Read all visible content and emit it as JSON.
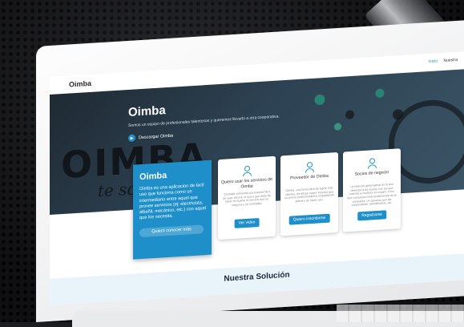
{
  "nav": {
    "logo": "Oimba",
    "links": [
      "Inicio",
      "Nuestra"
    ]
  },
  "hero": {
    "title": "Oimba",
    "subtitle": "Somos un equipo de profesionales talentosos y queremos llevarlo a otra cooperativa.",
    "button_label": "Descargar Oimba",
    "bg_word": "OIMBA",
    "bg_script": "te soluciona"
  },
  "intro_card": {
    "title": "Oimba",
    "text": "Oimba es una aplicacion de facil uso que funciona como un intermediario entre aquel que provee servicios (ej: electricista, albañil, mecánico, etc.) con aquel que los necesita.",
    "button_label": "Quiero conocer más"
  },
  "cards": [
    {
      "title": "Quiero usar los servicios de Oimba",
      "text": "Contratá, presenta una manera fácil de usar. Ahorrá, lo único que debe de hacer es buscar el servicio que su negocio y ¡lo contratás!",
      "button_label": "Ver video"
    },
    {
      "title": "Proveedor de Oimba",
      "text": "Oimba, una forma fácil de lograr mas clientes, de eficaz mayor impulso que un previo profesionalismo respaldando adentro de hacer uso.",
      "button_label": "Quiero inscribirme"
    },
    {
      "title": "Socios de negocio",
      "text": "La relación ganar-ganar es lo que describe a los socios con los que nuestra a conducir en equipo. A los que componen esta fundamental de la compañía. Un apuesto que las cooperativas, atendiéndolo, etc.",
      "button_label": "Registrarse"
    }
  ],
  "section": {
    "title": "Nuestra Solución"
  },
  "colors": {
    "accent": "#1e8fc9",
    "hero_dark": "#1f2a33",
    "section_bg": "#e8f3fa"
  }
}
